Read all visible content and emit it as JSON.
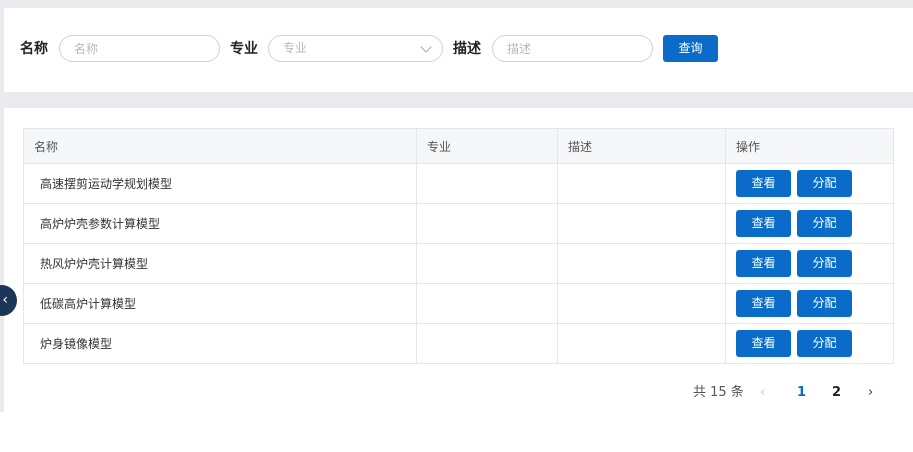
{
  "search": {
    "name_label": "名称",
    "name_placeholder": "名称",
    "major_label": "专业",
    "major_placeholder": "专业",
    "desc_label": "描述",
    "desc_placeholder": "描述",
    "query_label": "查询"
  },
  "table": {
    "columns": [
      "名称",
      "专业",
      "描述",
      "操作"
    ],
    "rows": [
      {
        "name": "高速摆剪运动学规划模型",
        "major": "",
        "desc": ""
      },
      {
        "name": "高炉炉壳参数计算模型",
        "major": "",
        "desc": ""
      },
      {
        "name": "热风炉炉壳计算模型",
        "major": "",
        "desc": ""
      },
      {
        "name": "低碳高炉计算模型",
        "major": "",
        "desc": ""
      },
      {
        "name": "炉身镜像模型",
        "major": "",
        "desc": ""
      }
    ],
    "view_label": "查看",
    "assign_label": "分配"
  },
  "pagination": {
    "total_text": "共 15 条",
    "prev_icon": "‹",
    "next_icon": "›",
    "pages": [
      "1",
      "2"
    ],
    "current_page": "1"
  },
  "sidebar_toggle": {
    "icon": "‹"
  },
  "colors": {
    "primary": "#0a6cc8",
    "background": "#e9ebef",
    "toggle": "#1d3557"
  }
}
